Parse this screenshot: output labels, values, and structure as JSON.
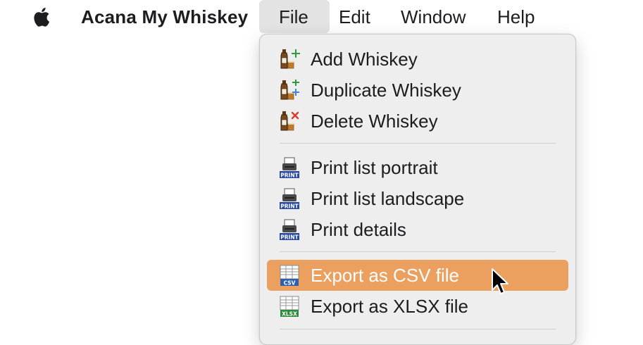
{
  "menubar": {
    "app_name": "Acana My Whiskey",
    "menus": [
      "File",
      "Edit",
      "Window",
      "Help"
    ],
    "active_menu": "File"
  },
  "file_menu": {
    "items": [
      {
        "label": "Add Whiskey",
        "icon": "add-whiskey-icon"
      },
      {
        "label": "Duplicate Whiskey",
        "icon": "duplicate-whiskey-icon"
      },
      {
        "label": "Delete Whiskey",
        "icon": "delete-whiskey-icon"
      },
      {
        "label": "Print list portrait",
        "icon": "print-icon"
      },
      {
        "label": "Print list landscape",
        "icon": "print-icon"
      },
      {
        "label": "Print details",
        "icon": "print-icon"
      },
      {
        "label": "Export as CSV file",
        "icon": "csv-export-icon",
        "highlighted": true
      },
      {
        "label": "Export as XLSX file",
        "icon": "xlsx-export-icon"
      }
    ],
    "icon_badges": {
      "print": "PRINT",
      "csv": "CSV",
      "xlsx": "XLSX"
    }
  },
  "colors": {
    "highlight": "#eba060",
    "menu_background": "#eeeeee",
    "active_menu_background": "#e3e3e3",
    "print_badge": "#2848a8",
    "csv_badge": "#2f5fb0",
    "xlsx_badge": "#2e8a3c"
  }
}
